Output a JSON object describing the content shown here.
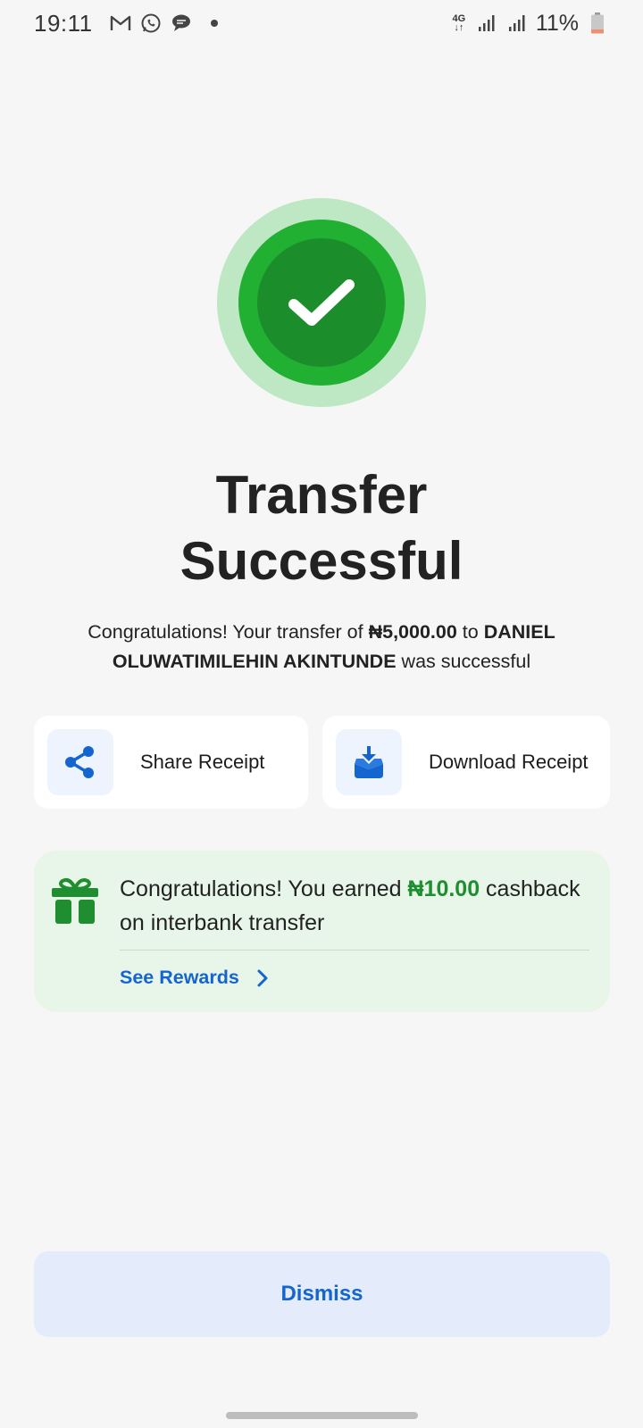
{
  "status_bar": {
    "time": "19:11",
    "network": "4G",
    "battery": "11%"
  },
  "colors": {
    "success_outer": "#bde8c3",
    "success_mid": "#22b033",
    "success_inner": "#1b8d2b",
    "accent_blue": "#1565d0",
    "cashback_bg": "#e8f5e9",
    "cashback_green": "#1e8e30"
  },
  "main": {
    "title_line1": "Transfer",
    "title_line2": "Successful",
    "message": {
      "prefix": "Congratulations! Your transfer of ",
      "amount": "₦5,000.00",
      "middle": " to ",
      "recipient": "DANIEL OLUWATIMILEHIN AKINTUNDE",
      "suffix": " was successful"
    }
  },
  "actions": {
    "share_label": "Share Receipt",
    "share_icon": "share-icon",
    "download_label": "Download Receipt",
    "download_icon": "download-icon"
  },
  "cashback": {
    "icon": "gift-icon",
    "text_prefix": "Congratulations! You earned ",
    "amount": "₦10.00",
    "text_suffix": " cashback on interbank transfer",
    "link_label": "See Rewards"
  },
  "footer": {
    "dismiss_label": "Dismiss"
  }
}
